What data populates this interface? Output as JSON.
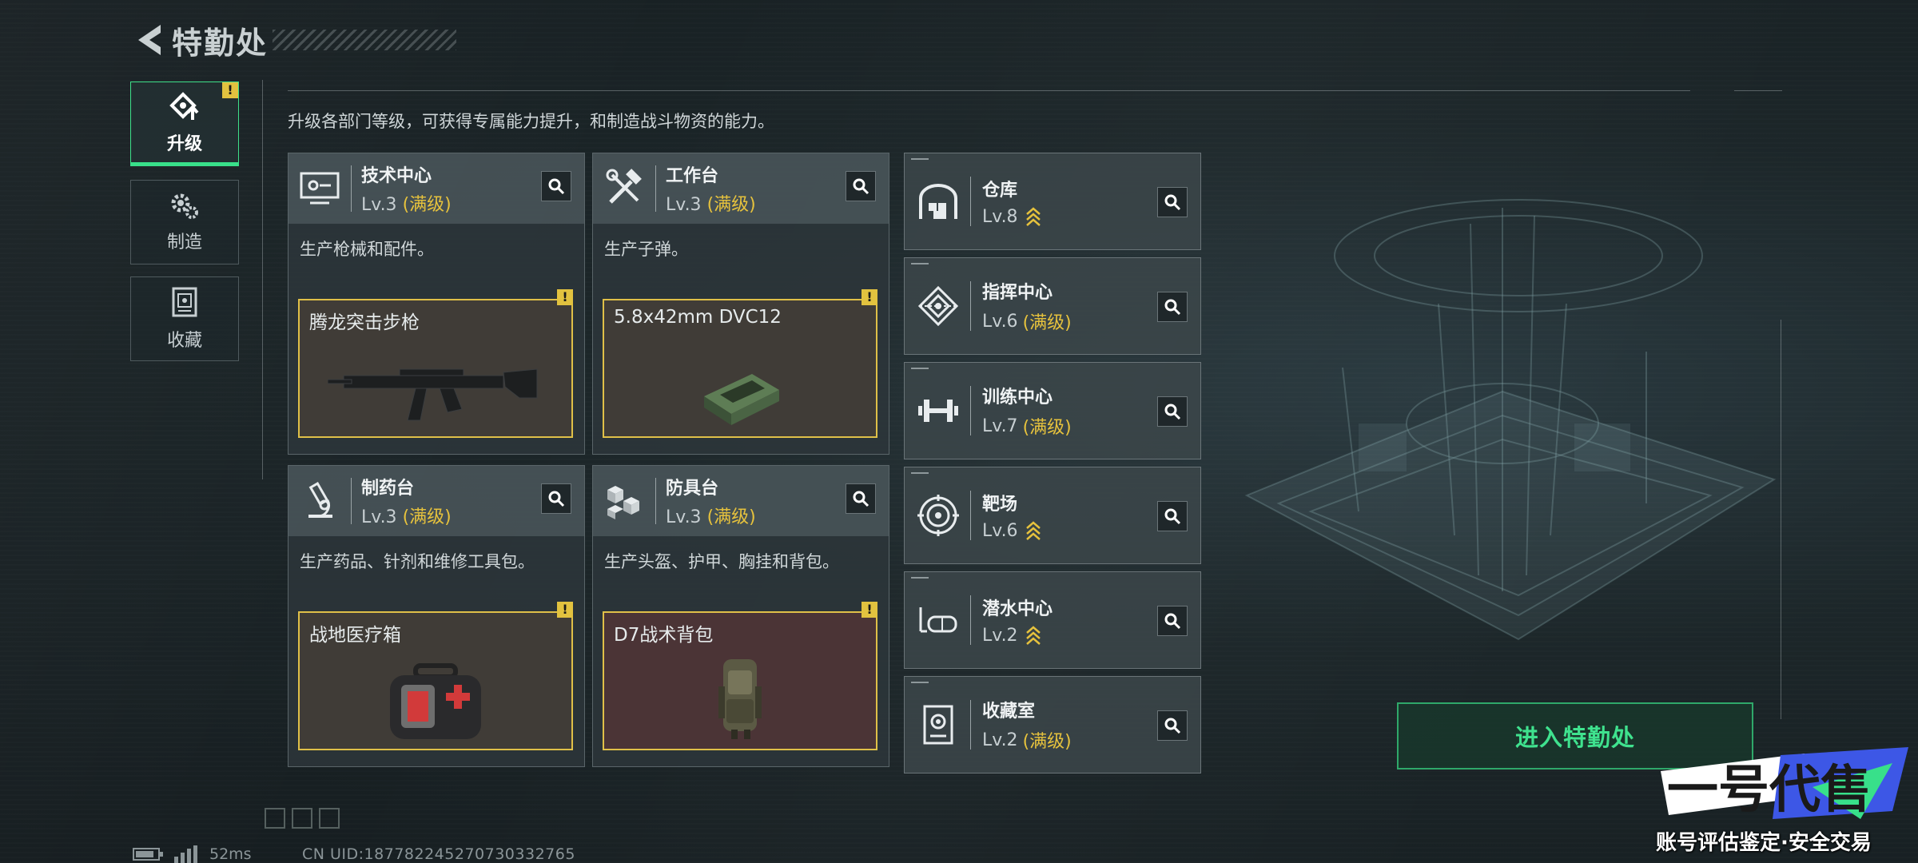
{
  "header": {
    "title": "特勤处"
  },
  "tabs": [
    {
      "label": "升级",
      "icon": "upgrade-icon",
      "active": true,
      "warning": "!"
    },
    {
      "label": "制造",
      "icon": "gears-icon",
      "active": false
    },
    {
      "label": "收藏",
      "icon": "collection-icon",
      "active": false
    }
  ],
  "description": "升级各部门等级，可获得专属能力提升，和制造战斗物资的能力。",
  "workbenches": [
    {
      "name": "技术中心",
      "level": "Lv.3",
      "max": "(满级)",
      "icon": "monitor-icon",
      "desc": "生产枪械和配件。",
      "item": "腾龙突击步枪",
      "item_icon": "rifle-icon",
      "warning": "!"
    },
    {
      "name": "工作台",
      "level": "Lv.3",
      "max": "(满级)",
      "icon": "tools-icon",
      "desc": "生产子弹。",
      "item": "5.8x42mm DVC12",
      "item_icon": "ammo-box-icon",
      "warning": "!"
    },
    {
      "name": "制药台",
      "level": "Lv.3",
      "max": "(满级)",
      "icon": "microscope-icon",
      "desc": "生产药品、针剂和维修工具包。",
      "item": "战地医疗箱",
      "item_icon": "medkit-icon",
      "warning": "!"
    },
    {
      "name": "防具台",
      "level": "Lv.3",
      "max": "(满级)",
      "icon": "cubes-icon",
      "desc": "生产头盔、护甲、胸挂和背包。",
      "item": "D7战术背包",
      "item_icon": "backpack-icon",
      "warning": "!"
    }
  ],
  "facilities": [
    {
      "name": "仓库",
      "level": "Lv.8",
      "max": "",
      "upgradable": true,
      "icon": "warehouse-icon"
    },
    {
      "name": "指挥中心",
      "level": "Lv.6",
      "max": "(满级)",
      "upgradable": false,
      "icon": "command-icon"
    },
    {
      "name": "训练中心",
      "level": "Lv.7",
      "max": "(满级)",
      "upgradable": false,
      "icon": "dumbbell-icon"
    },
    {
      "name": "靶场",
      "level": "Lv.6",
      "max": "",
      "upgradable": true,
      "icon": "target-icon"
    },
    {
      "name": "潜水中心",
      "level": "Lv.2",
      "max": "",
      "upgradable": true,
      "icon": "diving-mask-icon"
    },
    {
      "name": "收藏室",
      "level": "Lv.2",
      "max": "(满级)",
      "upgradable": false,
      "icon": "collection-room-icon"
    }
  ],
  "enter_button": "进入特勤处",
  "status": {
    "ping": "52ms",
    "uid": "CN UID:18778224527073033276​5"
  },
  "watermark": {
    "brand": "一号代售",
    "slogan": "账号评估鉴定·安全交易"
  },
  "colors": {
    "accent": "#3ee08a",
    "max_level": "#e6c23d",
    "warning": "#e2c23f"
  }
}
